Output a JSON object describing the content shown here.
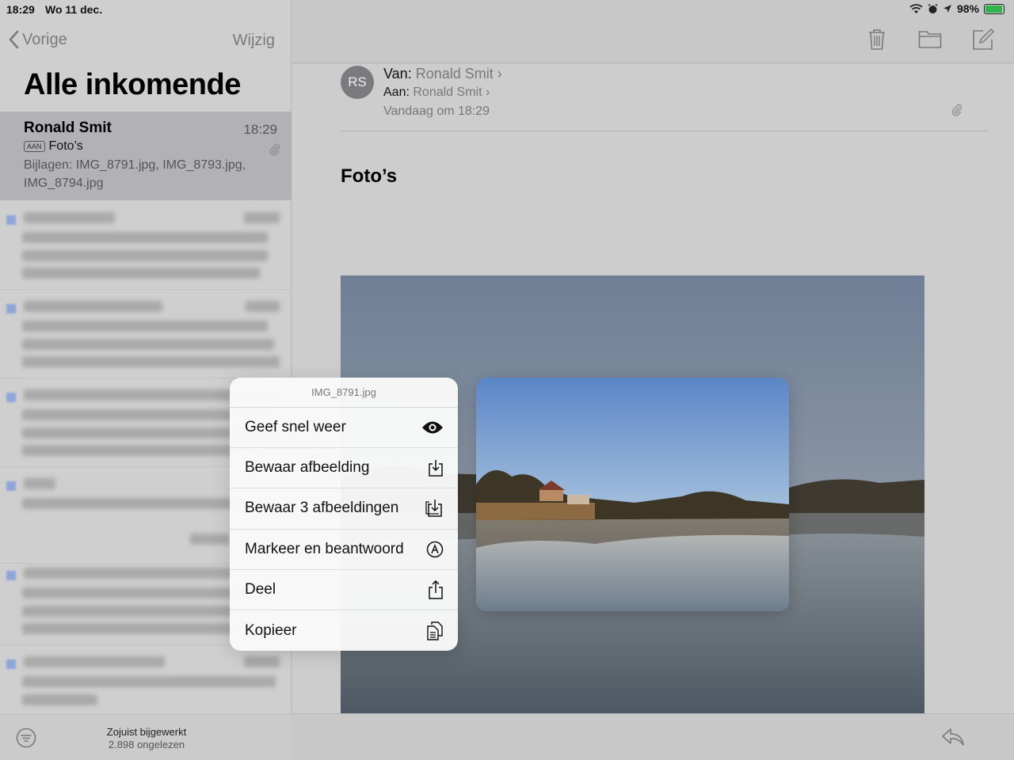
{
  "status": {
    "time": "18:29",
    "date": "Wo 11 dec.",
    "battery": "98%",
    "battery_level": 0.98
  },
  "sidebar": {
    "back_label": "Vorige",
    "edit_label": "Wijzig",
    "title": "Alle inkomende",
    "selected_mail": {
      "sender": "Ronald Smit",
      "time": "18:29",
      "badge": "AAN",
      "subject": "Foto’s",
      "preview": "Bijlagen: IMG_8791.jpg, IMG_8793.jpg, IMG_8794.jpg"
    },
    "footer": {
      "line1": "Zojuist bijgewerkt",
      "line2": "2.898 ongelezen"
    }
  },
  "message": {
    "avatar": "RS",
    "from_label": "Van:",
    "from_value": "Ronald Smit",
    "to_label": "Aan:",
    "to_value": "Ronald Smit",
    "date": "Vandaag om 18:29",
    "subject": "Foto’s"
  },
  "menu": {
    "title": "IMG_8791.jpg",
    "items": [
      {
        "label": "Geef snel weer",
        "icon": "eye-icon"
      },
      {
        "label": "Bewaar afbeelding",
        "icon": "save-image-icon"
      },
      {
        "label": "Bewaar 3 afbeeldingen",
        "icon": "save-images-icon"
      },
      {
        "label": "Markeer en beantwoord",
        "icon": "markup-icon"
      },
      {
        "label": "Deel",
        "icon": "share-icon"
      },
      {
        "label": "Kopieer",
        "icon": "copy-icon"
      }
    ]
  },
  "colors": {
    "accent": "#7a7a7a",
    "selected_row": "#b2b2b5",
    "battery": "#2fb34a"
  }
}
